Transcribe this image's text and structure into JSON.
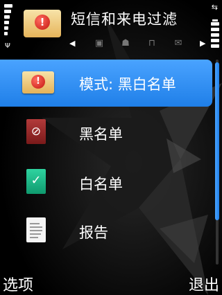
{
  "header": {
    "title": "短信和来电过滤",
    "app_icon": "message-alert-icon",
    "tabs": [
      {
        "icon": "calendar-edit-icon",
        "glyph": "▣"
      },
      {
        "icon": "person-icon",
        "glyph": "☗"
      },
      {
        "icon": "lock-icon",
        "glyph": "⊓"
      },
      {
        "icon": "envelope-icon",
        "glyph": "✉"
      }
    ],
    "arrow_left": "◀",
    "arrow_right": "▶"
  },
  "list": {
    "items": [
      {
        "label": "模式: 黑白名单",
        "icon": "message-alert-icon",
        "selected": true
      },
      {
        "label": "黑名单",
        "icon": "blacklist-icon",
        "selected": false
      },
      {
        "label": "白名单",
        "icon": "whitelist-check-icon",
        "selected": false
      },
      {
        "label": "报告",
        "icon": "report-document-icon",
        "selected": false
      }
    ]
  },
  "softkeys": {
    "left": "选项",
    "right": "退出"
  },
  "colors": {
    "selection": "#2b8cf3",
    "background": "#000000"
  }
}
